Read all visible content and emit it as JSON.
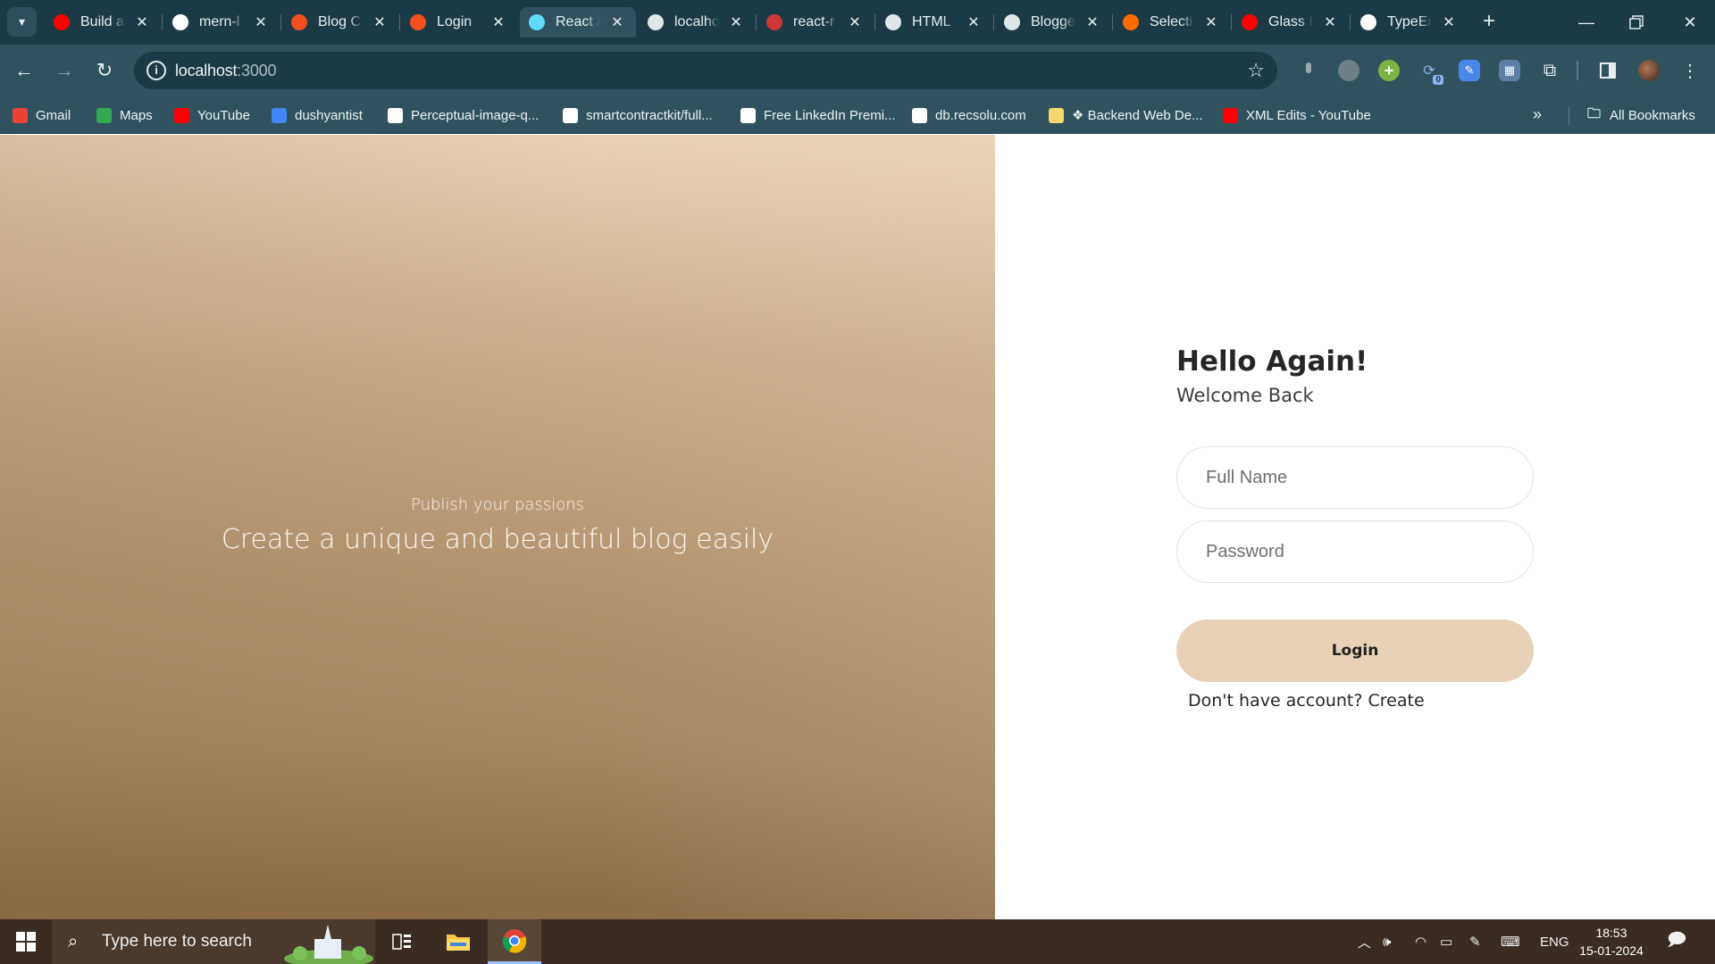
{
  "browser": {
    "tabs": [
      {
        "label": "Build a",
        "icon": "youtube-icon",
        "color": "#ff0000"
      },
      {
        "label": "mern-l",
        "icon": "github-icon",
        "color": "#ffffff"
      },
      {
        "label": "Blog C",
        "icon": "figma-icon",
        "color": "#f24e1e"
      },
      {
        "label": "Login",
        "icon": "figma-icon",
        "color": "#f24e1e"
      },
      {
        "label": "React /",
        "icon": "react-icon",
        "color": "#61dafb"
      },
      {
        "label": "localho",
        "icon": "globe-icon",
        "color": "#dfe7ea"
      },
      {
        "label": "react-r",
        "icon": "npm-icon",
        "color": "#cb3837"
      },
      {
        "label": "HTML",
        "icon": "html-icon",
        "color": "#dfe7ea"
      },
      {
        "label": "Blogge",
        "icon": "blogger-icon",
        "color": "#dfe7ea"
      },
      {
        "label": "Selecti",
        "icon": "brand-icon",
        "color": "#ff6b00"
      },
      {
        "label": "Glass I",
        "icon": "youtube-icon",
        "color": "#ff0000"
      },
      {
        "label": "TypeEr",
        "icon": "github-icon",
        "color": "#ffffff"
      }
    ],
    "active_tab_index": 4,
    "close_glyph": "✕",
    "new_tab_glyph": "+",
    "url_host": "localhost",
    "url_port": ":3000",
    "extension_badge": "0"
  },
  "bookmarks": [
    {
      "label": "Gmail",
      "icon": "gmail-icon",
      "color": "#ea4335"
    },
    {
      "label": "Maps",
      "icon": "maps-icon",
      "color": "#34a853"
    },
    {
      "label": "YouTube",
      "icon": "youtube-icon",
      "color": "#ff0000"
    },
    {
      "label": "dushyantist",
      "icon": "chart-icon",
      "color": "#4285f4"
    },
    {
      "label": "Perceptual-image-q...",
      "icon": "researchgate-icon",
      "color": "#ffffff"
    },
    {
      "label": "smartcontractkit/full...",
      "icon": "github-icon",
      "color": "#ffffff"
    },
    {
      "label": "Free LinkedIn Premi...",
      "icon": "globe-icon",
      "color": "#ffffff"
    },
    {
      "label": "db.recsolu.com",
      "icon": "globe-icon",
      "color": "#ffffff"
    },
    {
      "label": "❖ Backend Web De...",
      "icon": "note-icon",
      "color": "#f5d76e"
    },
    {
      "label": "XML Edits - YouTube",
      "icon": "youtube-icon",
      "color": "#ff0000"
    }
  ],
  "bookmarks_all_label": "All Bookmarks",
  "hero": {
    "kicker": "Publish your passions",
    "title": "Create a unique and beautiful blog easily"
  },
  "login": {
    "heading": "Hello Again!",
    "subheading": "Welcome Back",
    "name_placeholder": "Full Name",
    "password_placeholder": "Password",
    "button_label": "Login",
    "footer_prompt": "Don't have account?",
    "footer_link": "Create"
  },
  "taskbar": {
    "search_placeholder": "Type here to search",
    "language": "ENG",
    "time": "18:53",
    "date": "15-01-2024"
  },
  "colors": {
    "browser_frame": "#1c3a45",
    "browser_toolbar": "#2f525e",
    "login_button": "#e7d2b8",
    "hero_top": "#e8d1b3",
    "hero_bottom": "#8a6b44"
  }
}
